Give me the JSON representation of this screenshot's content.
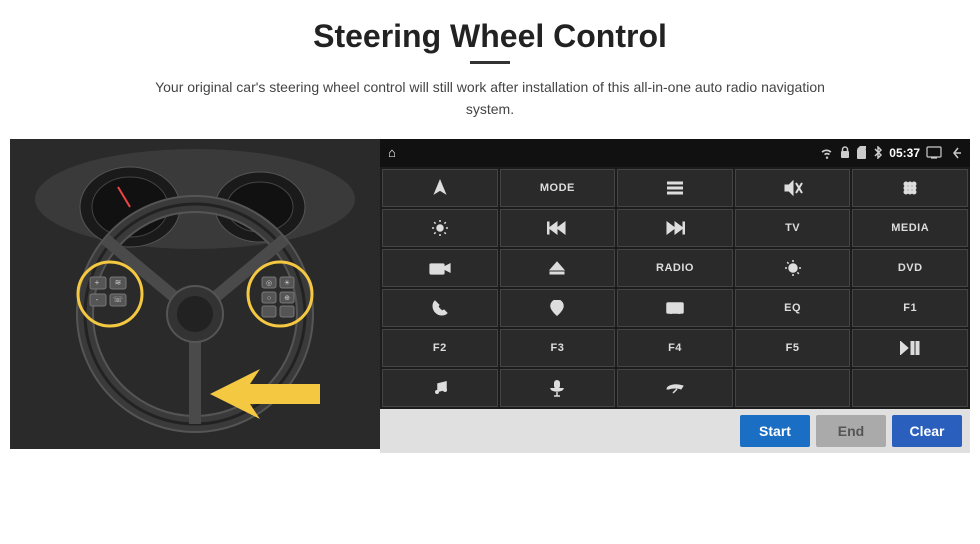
{
  "page": {
    "title": "Steering Wheel Control",
    "subtitle": "Your original car's steering wheel control will still work after installation of this all-in-one auto radio navigation system."
  },
  "status_bar": {
    "home_icon": "⌂",
    "wifi_icon": "wifi",
    "lock_icon": "lock",
    "sd_icon": "sd",
    "bt_icon": "bt",
    "time": "05:37",
    "screen_icon": "screen",
    "back_icon": "back"
  },
  "grid_buttons": [
    {
      "id": "nav",
      "icon": "nav",
      "label": ""
    },
    {
      "id": "mode",
      "icon": "",
      "label": "MODE"
    },
    {
      "id": "list",
      "icon": "list",
      "label": ""
    },
    {
      "id": "mute",
      "icon": "mute",
      "label": ""
    },
    {
      "id": "apps",
      "icon": "apps",
      "label": ""
    },
    {
      "id": "gear",
      "icon": "gear",
      "label": ""
    },
    {
      "id": "prev",
      "icon": "prev",
      "label": ""
    },
    {
      "id": "next",
      "icon": "next",
      "label": ""
    },
    {
      "id": "tv",
      "icon": "",
      "label": "TV"
    },
    {
      "id": "media",
      "icon": "",
      "label": "MEDIA"
    },
    {
      "id": "cam360",
      "icon": "cam360",
      "label": ""
    },
    {
      "id": "eject",
      "icon": "eject",
      "label": ""
    },
    {
      "id": "radio",
      "icon": "",
      "label": "RADIO"
    },
    {
      "id": "bright",
      "icon": "bright",
      "label": ""
    },
    {
      "id": "dvd",
      "icon": "",
      "label": "DVD"
    },
    {
      "id": "phone",
      "icon": "phone",
      "label": ""
    },
    {
      "id": "navi2",
      "icon": "navi2",
      "label": ""
    },
    {
      "id": "rect",
      "icon": "rect",
      "label": ""
    },
    {
      "id": "eq",
      "icon": "",
      "label": "EQ"
    },
    {
      "id": "f1",
      "icon": "",
      "label": "F1"
    },
    {
      "id": "f2",
      "icon": "",
      "label": "F2"
    },
    {
      "id": "f3",
      "icon": "",
      "label": "F3"
    },
    {
      "id": "f4",
      "icon": "",
      "label": "F4"
    },
    {
      "id": "f5",
      "icon": "",
      "label": "F5"
    },
    {
      "id": "playpause",
      "icon": "playpause",
      "label": ""
    },
    {
      "id": "music",
      "icon": "music",
      "label": ""
    },
    {
      "id": "mic",
      "icon": "mic",
      "label": ""
    },
    {
      "id": "hangup",
      "icon": "hangup",
      "label": ""
    },
    {
      "id": "empty1",
      "icon": "",
      "label": ""
    },
    {
      "id": "empty2",
      "icon": "",
      "label": ""
    }
  ],
  "action_buttons": {
    "start_label": "Start",
    "end_label": "End",
    "clear_label": "Clear"
  }
}
